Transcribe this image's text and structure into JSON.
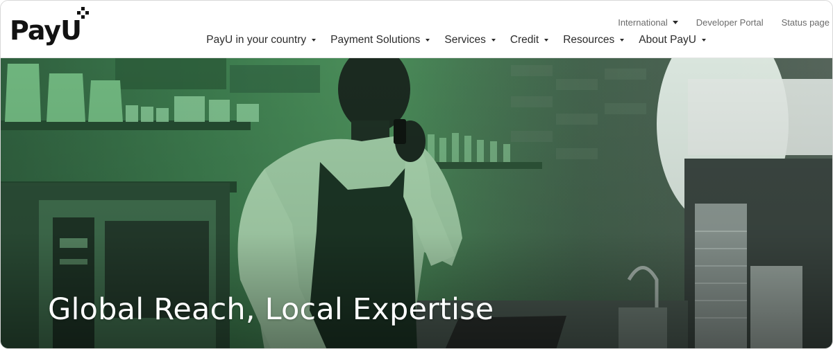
{
  "brand": {
    "logo_text": "PayU",
    "logo_color": "#121212"
  },
  "utility_nav": [
    {
      "label": "International",
      "has_dropdown": true
    },
    {
      "label": "Developer Portal",
      "has_dropdown": false
    },
    {
      "label": "Status page",
      "has_dropdown": false
    }
  ],
  "main_nav": [
    {
      "label": "PayU in your country",
      "has_dropdown": true
    },
    {
      "label": "Payment Solutions",
      "has_dropdown": true
    },
    {
      "label": "Services",
      "has_dropdown": true
    },
    {
      "label": "Credit",
      "has_dropdown": true
    },
    {
      "label": "Resources",
      "has_dropdown": true
    },
    {
      "label": "About PayU",
      "has_dropdown": true
    }
  ],
  "hero": {
    "heading": "Global Reach, Local Expertise",
    "image_tint": "#4b8e5a"
  },
  "colors": {
    "header_bg": "#ffffff",
    "nav_text": "#2b2b2b",
    "utility_text": "#6b6b6b",
    "hero_text": "#ffffff"
  }
}
